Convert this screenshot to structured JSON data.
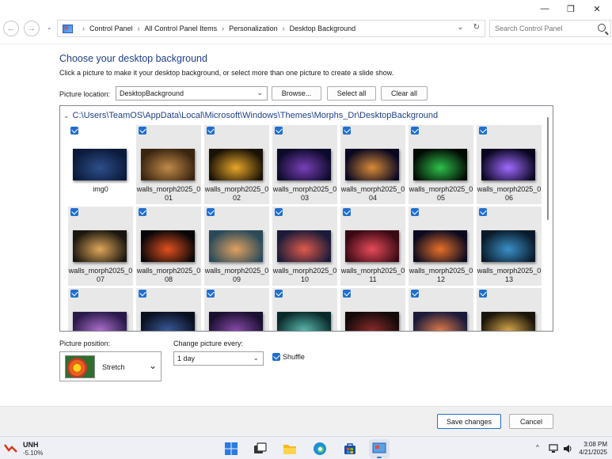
{
  "titlebar": {
    "minimize": "—",
    "restore": "❐",
    "close": "✕"
  },
  "address": {
    "crumbs": [
      "Control Panel",
      "All Control Panel Items",
      "Personalization",
      "Desktop Background"
    ],
    "search_placeholder": "Search Control Panel"
  },
  "main": {
    "heading": "Choose your desktop background",
    "subtext": "Click a picture to make it your desktop background, or select more than one picture to create a slide show.",
    "location_label": "Picture location:",
    "location_value": "DesktopBackground",
    "browse": "Browse...",
    "select_all": "Select all",
    "clear_all": "Clear all",
    "folder_path": "C:\\Users\\TeamOS\\AppData\\Local\\Microsoft\\Windows\\Themes\\Morphs_Dr\\DesktopBackground",
    "pictures": [
      {
        "caption": "img0",
        "colors": [
          "#0b1a3a",
          "#2d4e8a"
        ]
      },
      {
        "caption": "walls_morph2025_001",
        "colors": [
          "#3a2410",
          "#c08a4a"
        ]
      },
      {
        "caption": "walls_morph2025_002",
        "colors": [
          "#1a1206",
          "#e8a62a"
        ]
      },
      {
        "caption": "walls_morph2025_003",
        "colors": [
          "#0c0a2a",
          "#7a3fb8"
        ]
      },
      {
        "caption": "walls_morph2025_004",
        "colors": [
          "#0a0820",
          "#d98a3a"
        ]
      },
      {
        "caption": "walls_morph2025_005",
        "colors": [
          "#020a04",
          "#2fbf4a"
        ]
      },
      {
        "caption": "walls_morph2025_006",
        "colors": [
          "#0a0620",
          "#a06aff"
        ]
      },
      {
        "caption": "walls_morph2025_007",
        "colors": [
          "#1a1610",
          "#e0a85a"
        ]
      },
      {
        "caption": "walls_morph2025_008",
        "colors": [
          "#08060a",
          "#e2501e"
        ]
      },
      {
        "caption": "walls_morph2025_009",
        "colors": [
          "#2a4a5a",
          "#e0a060"
        ]
      },
      {
        "caption": "walls_morph2025_010",
        "colors": [
          "#1a1a3a",
          "#e05a4a"
        ]
      },
      {
        "caption": "walls_morph2025_011",
        "colors": [
          "#3a0a14",
          "#e84a5a"
        ]
      },
      {
        "caption": "walls_morph2025_012",
        "colors": [
          "#0a0a20",
          "#e8702a"
        ]
      },
      {
        "caption": "walls_morph2025_013",
        "colors": [
          "#0a1a2a",
          "#3a90c8"
        ]
      },
      {
        "caption": "",
        "colors": [
          "#2a1a4a",
          "#b070d0"
        ]
      },
      {
        "caption": "",
        "colors": [
          "#0a1020",
          "#3a5a9a"
        ]
      },
      {
        "caption": "",
        "colors": [
          "#1a1030",
          "#8a4aaa"
        ]
      },
      {
        "caption": "",
        "colors": [
          "#0a2a2a",
          "#5abab0"
        ]
      },
      {
        "caption": "",
        "colors": [
          "#140a0a",
          "#8a2a2a"
        ]
      },
      {
        "caption": "",
        "colors": [
          "#1a1a3a",
          "#e07a4a"
        ]
      },
      {
        "caption": "",
        "colors": [
          "#1a140a",
          "#d8a84a"
        ]
      }
    ],
    "position_label": "Picture position:",
    "position_value": "Stretch",
    "change_label": "Change picture every:",
    "change_value": "1 day",
    "shuffle_label": "Shuffle"
  },
  "footer": {
    "save": "Save changes",
    "cancel": "Cancel"
  },
  "taskbar": {
    "ticker": "UNH",
    "ticker_change": "-5.10%",
    "time": "3:08 PM",
    "date": "4/21/2025"
  }
}
